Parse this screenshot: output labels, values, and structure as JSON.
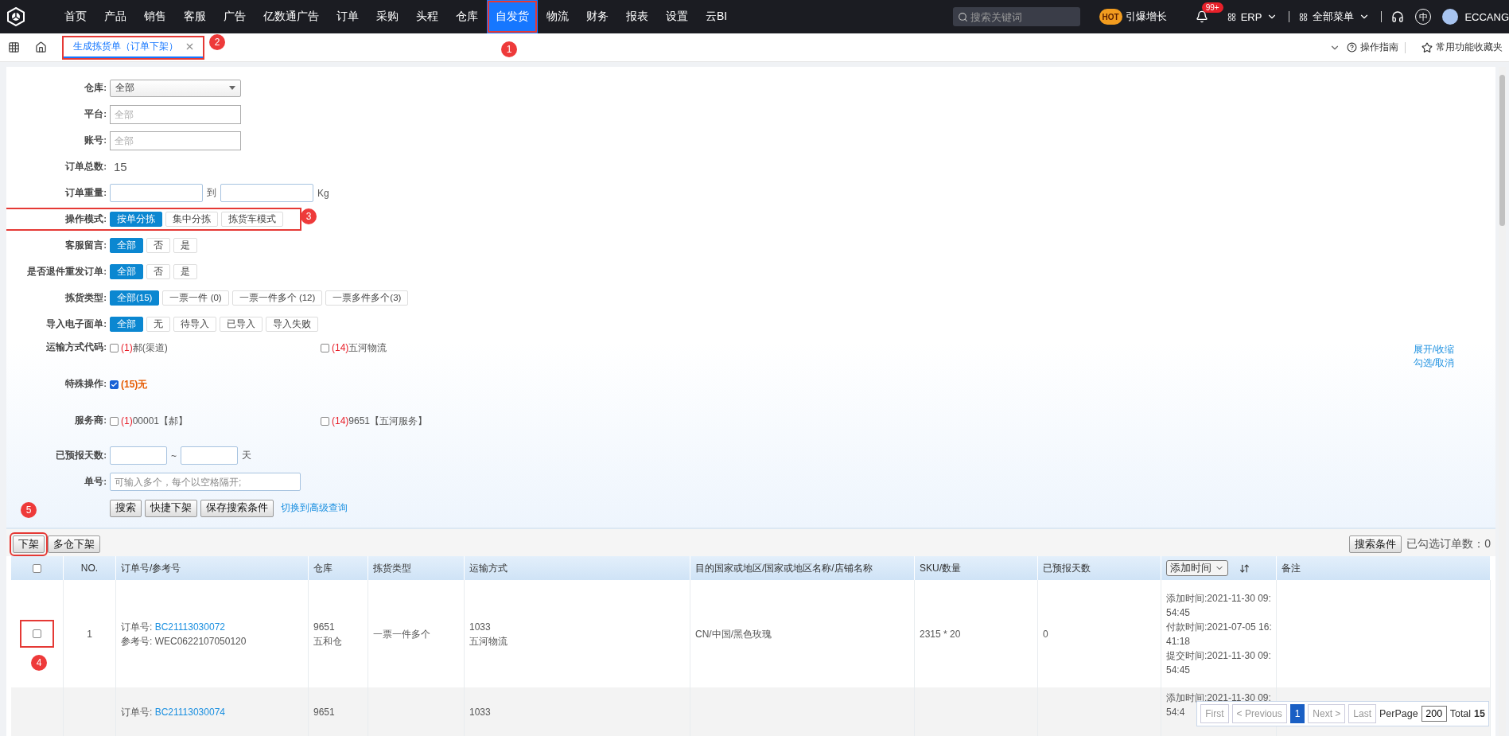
{
  "top_nav": {
    "items": [
      {
        "label": "首页",
        "selected": false
      },
      {
        "label": "产品",
        "selected": false
      },
      {
        "label": "销售",
        "selected": false
      },
      {
        "label": "客服",
        "selected": false
      },
      {
        "label": "广告",
        "selected": false
      },
      {
        "label": "亿数通广告",
        "selected": false
      },
      {
        "label": "订单",
        "selected": false
      },
      {
        "label": "采购",
        "selected": false
      },
      {
        "label": "头程",
        "selected": false
      },
      {
        "label": "仓库",
        "selected": false
      },
      {
        "label": "自发货",
        "selected": true,
        "callout": "1"
      },
      {
        "label": "物流",
        "selected": false
      },
      {
        "label": "财务",
        "selected": false
      },
      {
        "label": "报表",
        "selected": false
      },
      {
        "label": "设置",
        "selected": false
      },
      {
        "label": "云BI",
        "selected": false
      }
    ],
    "search": {
      "placeholder": "搜索关键词"
    },
    "promo": {
      "badge": "HOT",
      "label": "引爆增长"
    },
    "notifications": {
      "count": "99+"
    },
    "erp": "ERP",
    "all_menu": "全部菜单",
    "language": "中",
    "user": "ECCANG"
  },
  "tab_bar": {
    "tabs": [
      {
        "label": "生成拣货单（订单下架）",
        "selected": true,
        "callout": "2"
      }
    ],
    "guide": "操作指南",
    "favorites": "常用功能收藏夹"
  },
  "form": {
    "warehouse": {
      "label": "仓库:",
      "value": "全部"
    },
    "platform": {
      "label": "平台:",
      "placeholder": "全部"
    },
    "account": {
      "label": "账号:",
      "placeholder": "全部"
    },
    "order_total": {
      "label": "订单总数:",
      "value": "15"
    },
    "weight": {
      "label": "订单重量:",
      "separator": "到",
      "unit": "Kg"
    },
    "option_groups": [
      {
        "label": "操作模式:",
        "callout": "3",
        "options": [
          {
            "label": "按单分拣",
            "selected": true
          },
          {
            "label": "集中分拣",
            "selected": false
          },
          {
            "label": "拣货车模式",
            "selected": false
          }
        ]
      },
      {
        "label": "客服留言:",
        "options": [
          {
            "label": "全部",
            "selected": true
          },
          {
            "label": "否",
            "selected": false
          },
          {
            "label": "是",
            "selected": false
          }
        ]
      },
      {
        "label": "是否退件重发订单:",
        "options": [
          {
            "label": "全部",
            "selected": true
          },
          {
            "label": "否",
            "selected": false
          },
          {
            "label": "是",
            "selected": false
          }
        ]
      },
      {
        "label": "拣货类型:",
        "options": [
          {
            "label": "全部(15)",
            "selected": true
          },
          {
            "label": "一票一件 (0)",
            "selected": false
          },
          {
            "label": "一票一件多个 (12)",
            "selected": false
          },
          {
            "label": "一票多件多个(3)",
            "selected": false
          }
        ]
      },
      {
        "label": "导入电子面单:",
        "options": [
          {
            "label": "全部",
            "selected": true
          },
          {
            "label": "无",
            "selected": false
          },
          {
            "label": "待导入",
            "selected": false
          },
          {
            "label": "已导入",
            "selected": false
          },
          {
            "label": "导入失败",
            "selected": false
          }
        ]
      }
    ],
    "check_groups": [
      {
        "label": "运输方式代码:",
        "items": [
          {
            "count": "(1)",
            "text": "郝(渠道)",
            "checked": false
          },
          {
            "count": "(14)",
            "text": "五河物流",
            "checked": false
          }
        ]
      },
      {
        "label": "特殊操作:",
        "items": [
          {
            "count": "(15)",
            "text": "无",
            "checked": true
          }
        ]
      },
      {
        "label": "服务商:",
        "items": [
          {
            "count": "(1)",
            "text": "00001【郝】",
            "checked": false
          },
          {
            "count": "(14)",
            "text": "9651【五河服务】",
            "checked": false
          }
        ]
      }
    ],
    "toggle_links": [
      "展开/收缩",
      "勾选/取消"
    ],
    "forecast_days": {
      "label": "已预报天数:",
      "separator": "~",
      "unit": "天"
    },
    "order_no": {
      "label": "单号:",
      "placeholder": "可输入多个，每个以空格隔开;"
    },
    "buttons": [
      "搜索",
      "快捷下架",
      "保存搜索条件"
    ],
    "advanced_link": "切换到高级查询"
  },
  "toolbar": {
    "buttons": [
      {
        "label": "下架",
        "callout": "5"
      },
      {
        "label": "多仓下架"
      }
    ],
    "conditions_button": "搜索条件",
    "selected_count": {
      "label": "已勾选订单数：",
      "value": "0"
    }
  },
  "table": {
    "columns": [
      {
        "kind": "checkbox",
        "checked": false
      },
      {
        "kind": "text",
        "label": "NO."
      },
      {
        "kind": "text",
        "label": "订单号/参考号"
      },
      {
        "kind": "text",
        "label": "仓库"
      },
      {
        "kind": "text",
        "label": "拣货类型"
      },
      {
        "kind": "text",
        "label": "运输方式"
      },
      {
        "kind": "text",
        "label": "目的国家或地区/国家或地区名称/店铺名称"
      },
      {
        "kind": "text",
        "label": "SKU/数量"
      },
      {
        "kind": "text",
        "label": "已预报天数"
      },
      {
        "kind": "sort_select",
        "label": "添加时间"
      },
      {
        "kind": "text",
        "label": "备注"
      }
    ],
    "rows": [
      {
        "checked": false,
        "callout": "4",
        "no": "1",
        "order_label": "订单号:",
        "order_no": "BC21113030072",
        "ref_label": "参考号:",
        "ref_no": "WEC0622107050120",
        "warehouse": [
          "9651",
          "五和仓"
        ],
        "pick_type": "一票一件多个",
        "shipping": [
          "1033",
          "五河物流"
        ],
        "destination": "CN/中国/黑色玫瑰",
        "sku": "2315 * 20",
        "forecast_days": "0",
        "times": [
          "添加时间:2021-11-30 09:",
          "54:45",
          "付款时间:2021-07-05 16:",
          "41:18",
          "提交时间:2021-11-30 09:",
          "54:45"
        ]
      },
      {
        "order_label": "订单号:",
        "order_no": "BC21113030074",
        "warehouse": [
          "9651"
        ],
        "shipping": [
          "1033"
        ],
        "times": [
          "添加时间:2021-11-30 09:",
          "54:4"
        ]
      }
    ]
  },
  "pager": {
    "first": "First",
    "previous": "< Previous",
    "pages": [
      {
        "label": "1",
        "selected": true
      }
    ],
    "next": "Next >",
    "last": "Last",
    "per_page_label": "PerPage",
    "per_page": "200",
    "total_label": "Total",
    "total": "15"
  }
}
